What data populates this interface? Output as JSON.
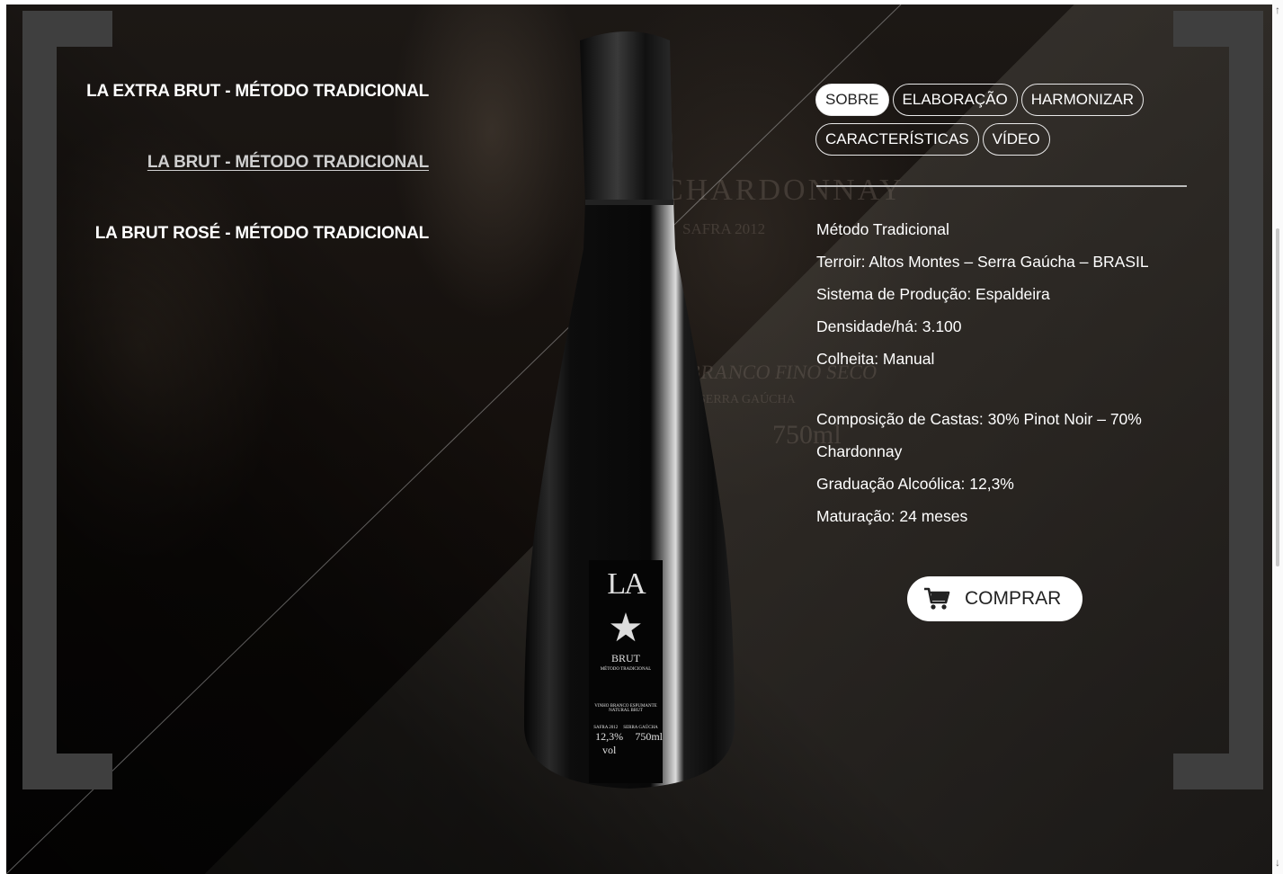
{
  "nav": {
    "items": [
      {
        "label": "LA EXTRA BRUT - MÉTODO TRADICIONAL",
        "active": false
      },
      {
        "label": "LA BRUT - MÉTODO TRADICIONAL",
        "active": true
      },
      {
        "label": "LA BRUT ROSÉ - MÉTODO TRADICIONAL",
        "active": false
      }
    ]
  },
  "tabs": [
    {
      "label": "SOBRE",
      "active": true
    },
    {
      "label": "ELABORAÇÃO",
      "active": false
    },
    {
      "label": "HARMONIZAR",
      "active": false
    },
    {
      "label": "CARACTERÍSTICAS",
      "active": false
    },
    {
      "label": "VÍDEO",
      "active": false
    }
  ],
  "info": {
    "group1": [
      "Método Tradicional",
      "Terroir: Altos Montes – Serra Gaúcha – BRASIL",
      "Sistema de Produção: Espaldeira",
      "Densidade/há: 3.100",
      "Colheita: Manual"
    ],
    "group2": [
      "Composição de Castas: 30% Pinot Noir – 70% Chardonnay",
      "Graduação Alcoólica: 12,3%",
      "Maturação: 24 meses"
    ]
  },
  "buy": {
    "label": "COMPRAR",
    "icon": "cart-icon"
  },
  "bottle_label": {
    "brand": "LA",
    "name": "BRUT",
    "method": "MÉTODO TRADICIONAL",
    "type_line1": "VINHO BRANCO ESPUMANTE",
    "type_line2": "NATURAL BRUT",
    "safra": "SAFRA 2012",
    "region": "SERRA GAÚCHA",
    "abv": "12,3% vol",
    "volume": "750ml"
  },
  "background": {
    "chardonnay": "CHARDONNAY",
    "safra": "SAFRA 2012",
    "branco": "BRANCO FINO SECO",
    "serra": "SERRA GAÚCHA",
    "ml": "750ml"
  },
  "colors": {
    "bracket": "#3f3f3f",
    "text": "#ffffff",
    "active_tab_bg": "#ffffff"
  }
}
